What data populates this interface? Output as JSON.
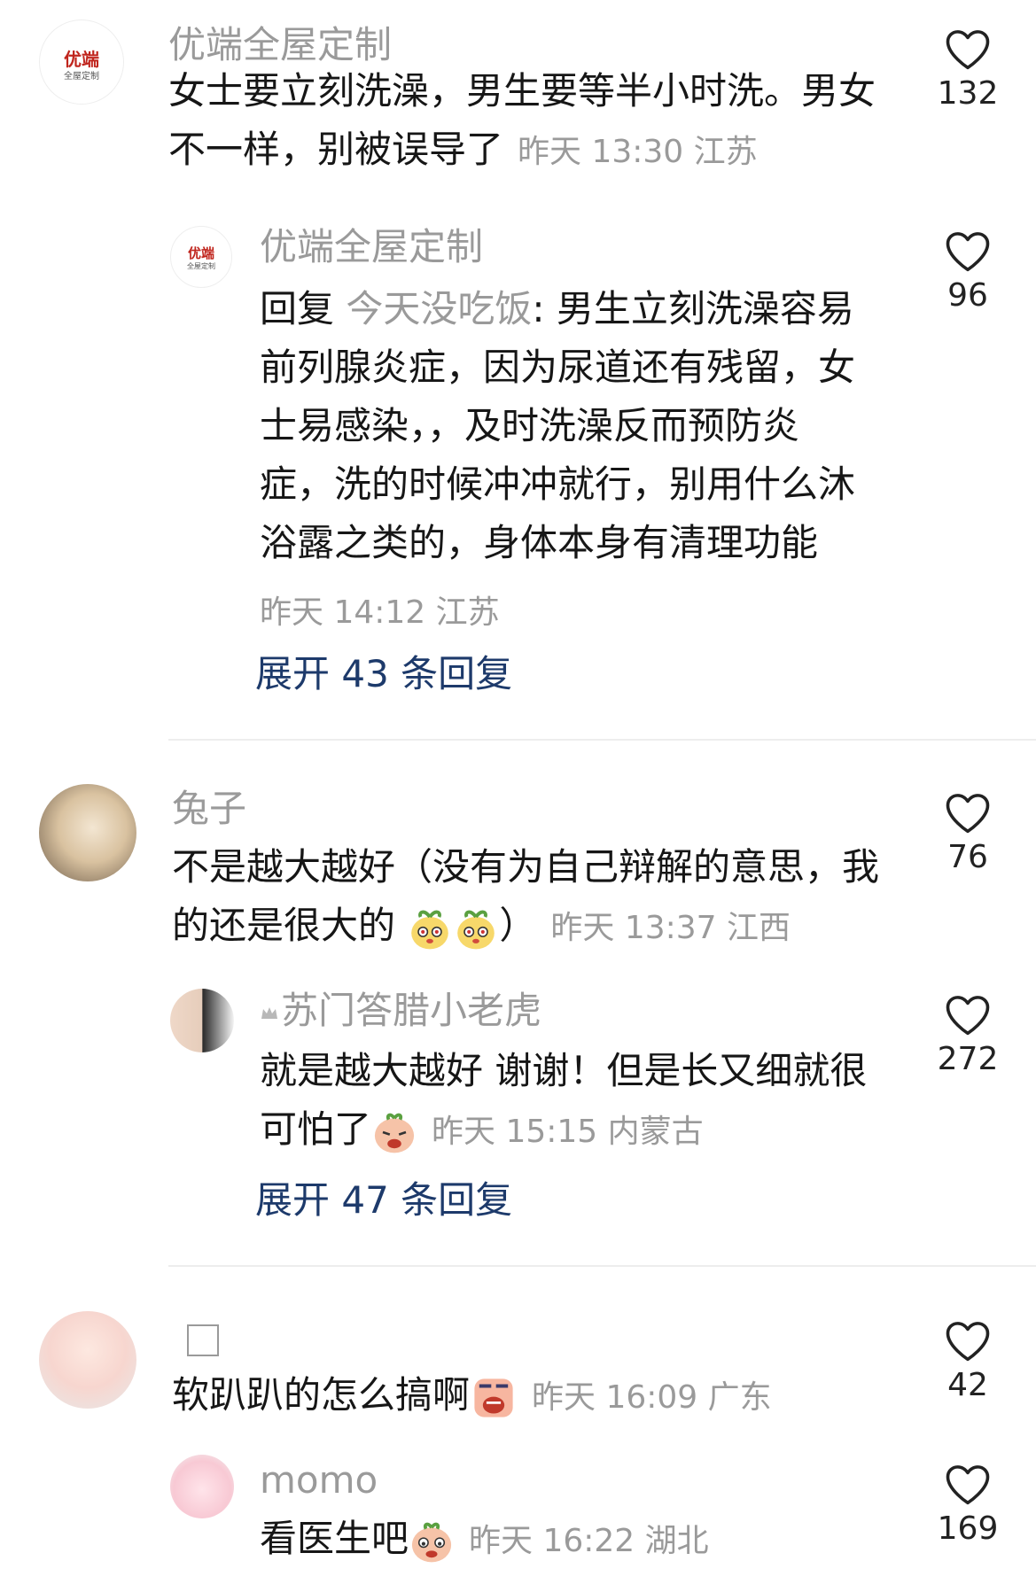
{
  "comments": [
    {
      "user": "优端全屋定制",
      "avatar_text": "优端",
      "avatar_subtext": "全屋定制",
      "lines": [
        "女士要立刻洗澡，男生要等半小时洗。男女",
        "不一样，别被误导了"
      ],
      "meta": "昨天 13:30 江苏",
      "likes": "132"
    },
    {
      "user": "优端全屋定制",
      "avatar_text": "优端",
      "avatar_subtext": "全屋定制",
      "reply_prefix": "回复",
      "reply_to": "今天没吃饭",
      "line1_rest": ": 男生立刻洗澡容易",
      "lines": [
        "前列腺炎症，因为尿道还有残留，女",
        "士易感染，，及时洗澡反而预防炎",
        "症，洗的时候冲冲就行，别用什么沐",
        "浴露之类的，身体本身有清理功能"
      ],
      "meta": "昨天 14:12 江苏",
      "likes": "96",
      "expand": "展开 43 条回复"
    },
    {
      "user": "兔子",
      "lines": [
        "不是越大越好（没有为自己辩解的意思，我",
        "的还是很大的"
      ],
      "line2_close": "）",
      "meta": "昨天 13:37 江西",
      "likes": "76"
    },
    {
      "user": "苏门答腊小老虎",
      "lines": [
        "就是越大越好 谢谢！但是长又细就很",
        "可怕了"
      ],
      "meta": "昨天 15:15 内蒙古",
      "likes": "272",
      "expand": "展开 47 条回复"
    },
    {
      "user": "",
      "lines": [
        "软趴趴的怎么搞啊"
      ],
      "meta": "昨天 16:09 广东",
      "likes": "42"
    },
    {
      "user": "momo",
      "lines": [
        "看医生吧"
      ],
      "meta": "昨天 16:22 湖北",
      "likes": "169"
    }
  ],
  "colors": {
    "text": "#161616",
    "meta": "#9a9a9a",
    "expand": "#1d3a6b",
    "divider": "#ededed"
  },
  "icons": [
    "heart-outline-icon",
    "crown-icon",
    "checkbox-icon"
  ]
}
